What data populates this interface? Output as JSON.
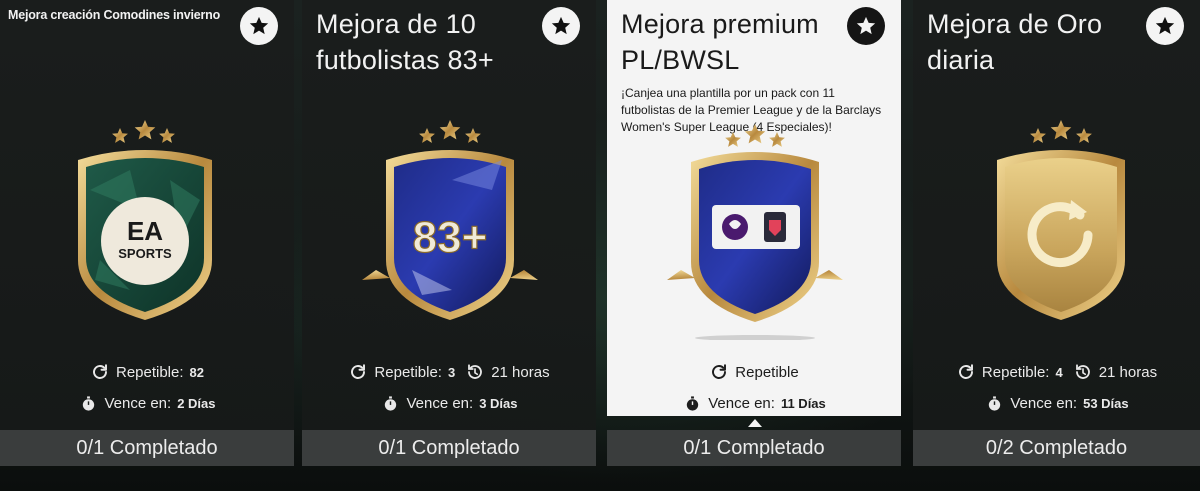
{
  "cards": [
    {
      "title": "Mejora creación Comodines invierno",
      "repeatable_label": "Repetible:",
      "repeatable_count": "82",
      "expires_label": "Vence en:",
      "expires_value": "2 Días",
      "progress_text": "0/1 Completado",
      "badge_text": "EA SPORTS"
    },
    {
      "title": "Mejora de 10 futbolistas 83+",
      "repeatable_label": "Repetible:",
      "repeatable_count": "3",
      "time_left": "21 horas",
      "expires_label": "Vence en:",
      "expires_value": "3 Días",
      "progress_text": "0/1 Completado",
      "badge_text": "83+"
    },
    {
      "title": "Mejora premium PL/BWSL",
      "description": "¡Canjea una plantilla por un pack con 11 futbolistas de la Premier League y de la Barclays Women's Super League (4 Especiales)!",
      "repeatable_label": "Repetible",
      "expires_label": "Vence en:",
      "expires_value": "11 Días",
      "progress_text": "0/1 Completado"
    },
    {
      "title": "Mejora de Oro diaria",
      "repeatable_label": "Repetible:",
      "repeatable_count": "4",
      "time_left": "21 horas",
      "expires_label": "Vence en:",
      "expires_value": "53 Días",
      "progress_text": "0/2 Completado"
    }
  ],
  "icons": {
    "favorite": "star-icon",
    "repeat": "refresh-icon",
    "time": "history-icon",
    "expires": "stopwatch-icon"
  },
  "colors": {
    "card_dark": "#1a1d1c",
    "card_selected": "#f4f4f4",
    "footer": "#3a3d3d",
    "gold": "#d8b56a"
  }
}
